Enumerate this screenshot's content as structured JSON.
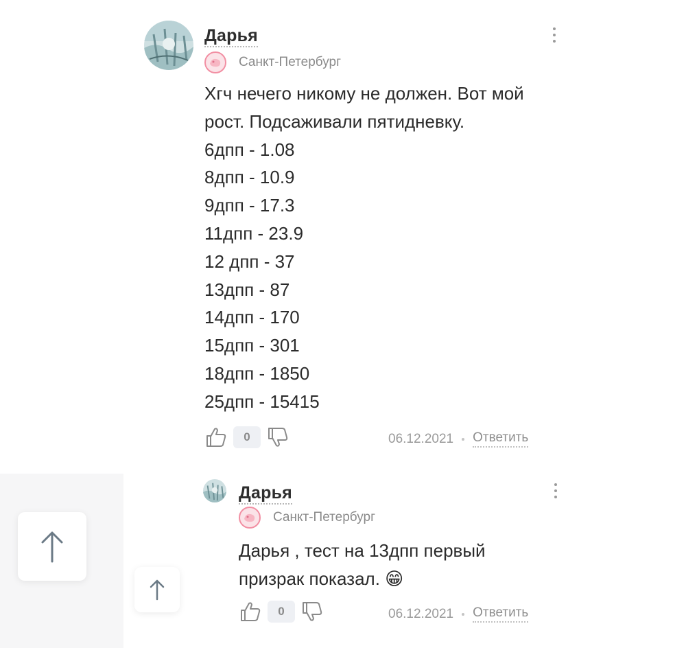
{
  "comments": [
    {
      "author": "Дарья",
      "city": "Санкт-Петербург",
      "avatar_icon": "avatar-image",
      "city_icon": "city-badge-icon",
      "lines": [
        "Хгч нечего никому не должен. Вот мой",
        "рост. Подсаживали пятидневку.",
        "6дпп - 1.08",
        "8дпп - 10.9",
        "9дпп - 17.3",
        "11дпп - 23.9",
        "12 дпп - 37",
        "13дпп - 87",
        "14дпп - 170",
        "15дпп - 301",
        "18дпп - 1850",
        "25дпп - 15415"
      ],
      "score": "0",
      "date": "06.12.2021",
      "reply_label": "Ответить"
    },
    {
      "author": "Дарья",
      "city": "Санкт-Петербург",
      "avatar_icon": "avatar-image",
      "city_icon": "city-badge-icon",
      "lines": [
        "Дарья , тест на 13дпп первый",
        "призрак показал. 😁"
      ],
      "score": "0",
      "date": "06.12.2021",
      "reply_label": "Ответить"
    }
  ],
  "icons": {
    "like": "thumbs-up-icon",
    "dislike": "thumbs-down-icon",
    "menu": "more-vertical-icon",
    "scroll_up": "arrow-up-icon"
  },
  "colors": {
    "text": "#2b2b2b",
    "muted": "#8a8a8a",
    "score_bg": "#eef0f4",
    "badge_pink": "#f28fa3"
  }
}
